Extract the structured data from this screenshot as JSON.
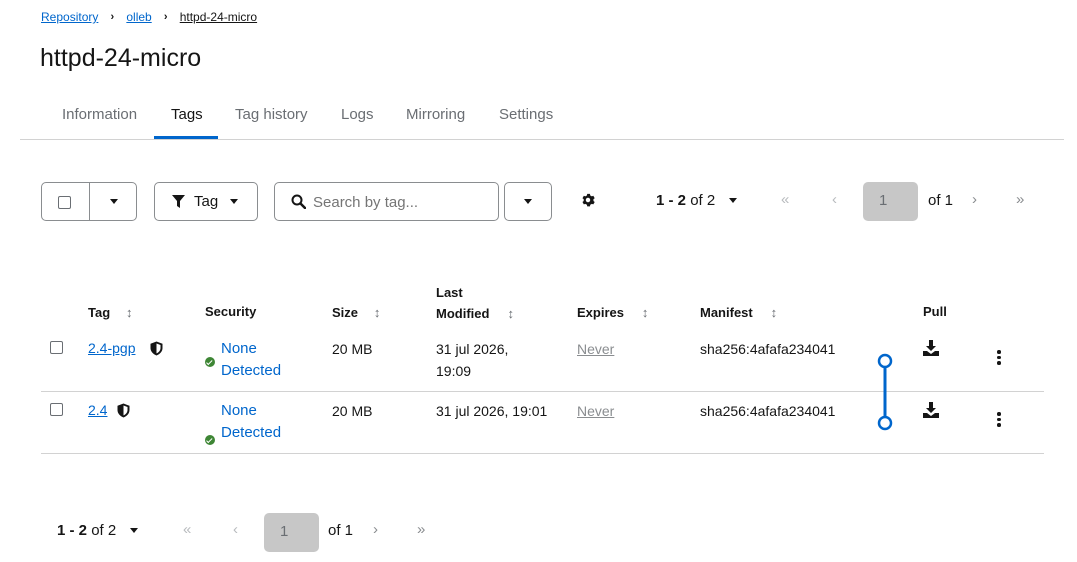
{
  "breadcrumb": {
    "items": [
      "Repository",
      "olleb"
    ],
    "current": "httpd-24-micro"
  },
  "page": {
    "title": "httpd-24-micro"
  },
  "tabs": [
    "Information",
    "Tags",
    "Tag history",
    "Logs",
    "Mirroring",
    "Settings"
  ],
  "active_tab": "Tags",
  "toolbar": {
    "filter_label": "Tag",
    "search_placeholder": "Search by tag...",
    "pagination_range": "1 - 2",
    "pagination_of": "of 2",
    "page_input": "1",
    "page_of": "of 1"
  },
  "table": {
    "headers": {
      "tag": "Tag",
      "security": "Security",
      "size": "Size",
      "last_modified_1": "Last",
      "last_modified_2": "Modified",
      "expires": "Expires",
      "manifest": "Manifest",
      "pull": "Pull"
    },
    "rows": [
      {
        "tag": "2.4-pgp",
        "security_1": "None",
        "security_2": "Detected",
        "size": "20 MB",
        "modified_1": "31 jul 2026,",
        "modified_2": "19:09",
        "expires": "Never",
        "manifest": "sha256:4afafa234041"
      },
      {
        "tag": "2.4",
        "security_1": "None",
        "security_2": "Detected",
        "size": "20 MB",
        "modified_1": "31 jul 2026, 19:01",
        "modified_2": "",
        "expires": "Never",
        "manifest": "sha256:4afafa234041"
      }
    ]
  },
  "footer": {
    "pagination_range": "1 - 2",
    "pagination_of": "of 2",
    "page_input": "1",
    "page_of": "of 1"
  },
  "colors": {
    "link": "#0066cc",
    "success": "#3e8635",
    "manifest_link": "#0066cc"
  }
}
